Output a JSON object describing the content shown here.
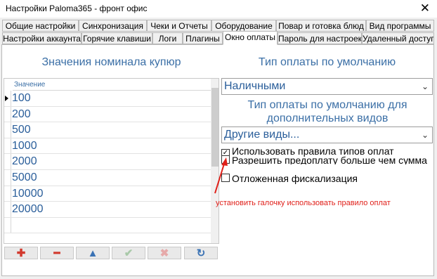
{
  "window": {
    "title": "Настройки Paloma365 - фронт офис",
    "close_glyph": "✕"
  },
  "tabs_row1": [
    "Общие настройки",
    "Синхронизация",
    "Чеки и Отчеты",
    "Оборудование",
    "Повар и готовка блюд",
    "Вид программы"
  ],
  "tabs_row2": [
    "Настройки аккаунта",
    "Горячие клавиши",
    "Логи",
    "Плагины",
    "Окно оплаты",
    "Пароль для настроек",
    "Удаленный доступ"
  ],
  "left": {
    "heading": "Значения номинала купюр",
    "column_header": "Значение",
    "rows": [
      "100",
      "200",
      "500",
      "1000",
      "2000",
      "5000",
      "10000",
      "20000"
    ],
    "buttons": [
      {
        "name": "add",
        "glyph": "✚",
        "color": "#d23a2e"
      },
      {
        "name": "remove",
        "glyph": "━",
        "color": "#d23a2e"
      },
      {
        "name": "move-up",
        "glyph": "▲",
        "color": "#3a72b4"
      },
      {
        "name": "confirm",
        "glyph": "✔",
        "color": "#a9c9a9"
      },
      {
        "name": "cancel",
        "glyph": "✖",
        "color": "#e6a9a9"
      },
      {
        "name": "refresh",
        "glyph": "↻",
        "color": "#3a72b4"
      }
    ]
  },
  "right": {
    "payment_heading": "Тип оплаты по умолчанию",
    "payment_select": "Наличными",
    "extra_heading": "Тип оплаты по умолчанию для дополнительных видов",
    "extra_select": "Другие виды...",
    "checkboxes": [
      {
        "label": "Использовать правила типов оплат",
        "checked": true
      },
      {
        "label": "Разрешить предоплату больше чем сумма чека",
        "checked": false
      },
      {
        "label": "Отложенная фискализация",
        "checked": false
      }
    ],
    "annotation": "установить галочку использовать правило оплат"
  }
}
